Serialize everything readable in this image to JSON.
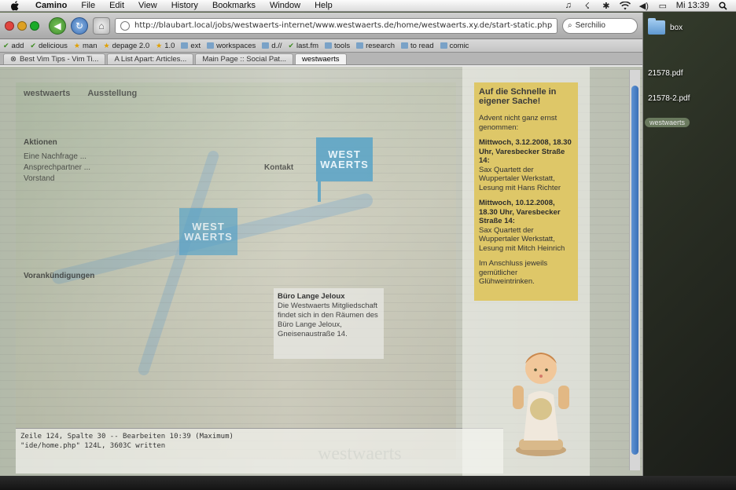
{
  "menubar": {
    "app": "Camino",
    "items": [
      "File",
      "Edit",
      "View",
      "History",
      "Bookmarks",
      "Window",
      "Help"
    ],
    "clock": "Mi 13:39"
  },
  "toolbar": {
    "url": "http://blaubart.local/jobs/westwaerts-internet/www.westwaerts.de/home/westwaerts.xy.de/start-static.php",
    "search_value": "Serchilio"
  },
  "bookmarks": [
    {
      "label": "add",
      "icon": "check"
    },
    {
      "label": "delicious",
      "icon": "check"
    },
    {
      "label": "man",
      "icon": "star"
    },
    {
      "label": "depage 2.0",
      "icon": "star"
    },
    {
      "label": "1.0",
      "icon": "star"
    },
    {
      "label": "ext",
      "icon": "folder"
    },
    {
      "label": "workspaces",
      "icon": "folder"
    },
    {
      "label": "d.//",
      "icon": "folder"
    },
    {
      "label": "last.fm",
      "icon": "check"
    },
    {
      "label": "tools",
      "icon": "folder"
    },
    {
      "label": "research",
      "icon": "folder"
    },
    {
      "label": "to read",
      "icon": "folder"
    },
    {
      "label": "comic",
      "icon": "folder"
    }
  ],
  "tabs": [
    {
      "label": "Best Vim Tips - Vim Ti..."
    },
    {
      "label": "A List Apart: Articles..."
    },
    {
      "label": "Main Page :: Social Pat..."
    },
    {
      "label": "westwaerts"
    }
  ],
  "page": {
    "nav": [
      "westwaerts",
      "Ausstellung"
    ],
    "side_heading": "Aktionen",
    "side_items": [
      "Eine Nachfrage ...",
      "Ansprechpartner ...",
      "Vorstand"
    ],
    "side_heading2": "Vorankündigungen",
    "kontakt_title": "Kontakt",
    "badge_text": [
      "WEST",
      "WAERTS"
    ],
    "buero_title": "Büro Lange Jeloux",
    "buero_text": "Die Westwaerts Mitgliedschaft findet sich in den Räumen des Büro Lange Jeloux, Gneisenaustraße 14.",
    "wordmark": "westwaerts",
    "console_lines": [
      "Zeile 124, Spalte 30 -- Bearbeiten 10:39 (Maximum)",
      "\"ide/home.php\" 124L, 3603C written"
    ]
  },
  "notice": {
    "title": "Auf die Schnelle in eigener Sache!",
    "intro": "Advent nicht ganz ernst genommen:",
    "event1_when": "Mittwoch, 3.12.2008, 18.30 Uhr, Varesbecker Straße 14:",
    "event1_text": "Sax Quartett der Wuppertaler Werkstatt, Lesung mit Hans Richter",
    "event2_when": "Mittwoch, 10.12.2008, 18.30 Uhr, Varesbecker Straße 14:",
    "event2_text": "Sax Quartett der Wuppertaler Werkstatt, Lesung mit Mitch Heinrich",
    "outro": "Im Anschluss jeweils gemütlicher Glühweintrinken."
  },
  "desktop": {
    "items": [
      {
        "label": "box",
        "icon": "folder-icon"
      },
      {
        "label": "21578.pdf",
        "icon": "pdf-icon"
      },
      {
        "label": "21578-2.pdf",
        "icon": "pdf-icon"
      }
    ],
    "tag": "westwaerts"
  },
  "colors": {
    "notice_bg": "#dec45c",
    "badge_blue": "#50a0c8",
    "scroll_thumb": "#3a6fb7"
  }
}
